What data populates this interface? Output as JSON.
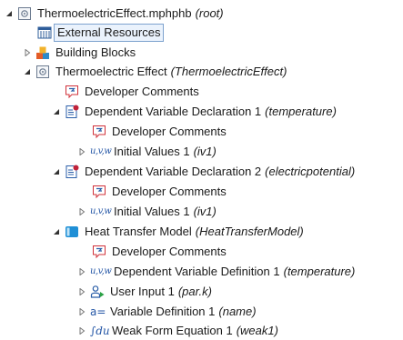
{
  "rows": [
    {
      "label": "ThermoelectricEffect.mphphb",
      "extra": "(root)"
    },
    {
      "label": "External Resources",
      "extra": ""
    },
    {
      "label": "Building Blocks",
      "extra": ""
    },
    {
      "label": "Thermoelectric Effect",
      "extra": "(ThermoelectricEffect)"
    },
    {
      "label": "Developer Comments",
      "extra": ""
    },
    {
      "label": "Dependent Variable Declaration 1",
      "extra": "(temperature)"
    },
    {
      "label": "Developer Comments",
      "extra": ""
    },
    {
      "label": "Initial Values 1",
      "extra": "(iv1)"
    },
    {
      "label": "Dependent Variable Declaration 2",
      "extra": "(electricpotential)"
    },
    {
      "label": "Developer Comments",
      "extra": ""
    },
    {
      "label": "Initial Values 1",
      "extra": "(iv1)"
    },
    {
      "label": "Heat Transfer Model",
      "extra": "(HeatTransferModel)"
    },
    {
      "label": "Developer Comments",
      "extra": ""
    },
    {
      "label": "Dependent Variable Definition 1",
      "extra": "(temperature)"
    },
    {
      "label": "User Input 1",
      "extra": "(par.k)"
    },
    {
      "label": "Variable Definition 1",
      "extra": "(name)"
    },
    {
      "label": "Weak Form Equation 1",
      "extra": "(weak1)"
    }
  ],
  "icon_glyphs": {
    "uvw": "u,v,w",
    "aeq": "a=",
    "fdu": "∫du"
  },
  "colors": {
    "selection_border": "#7da2ce",
    "selection_fill": "#eaf2fc",
    "icon_blue": "#2456a6",
    "icon_red": "#c0213a"
  }
}
